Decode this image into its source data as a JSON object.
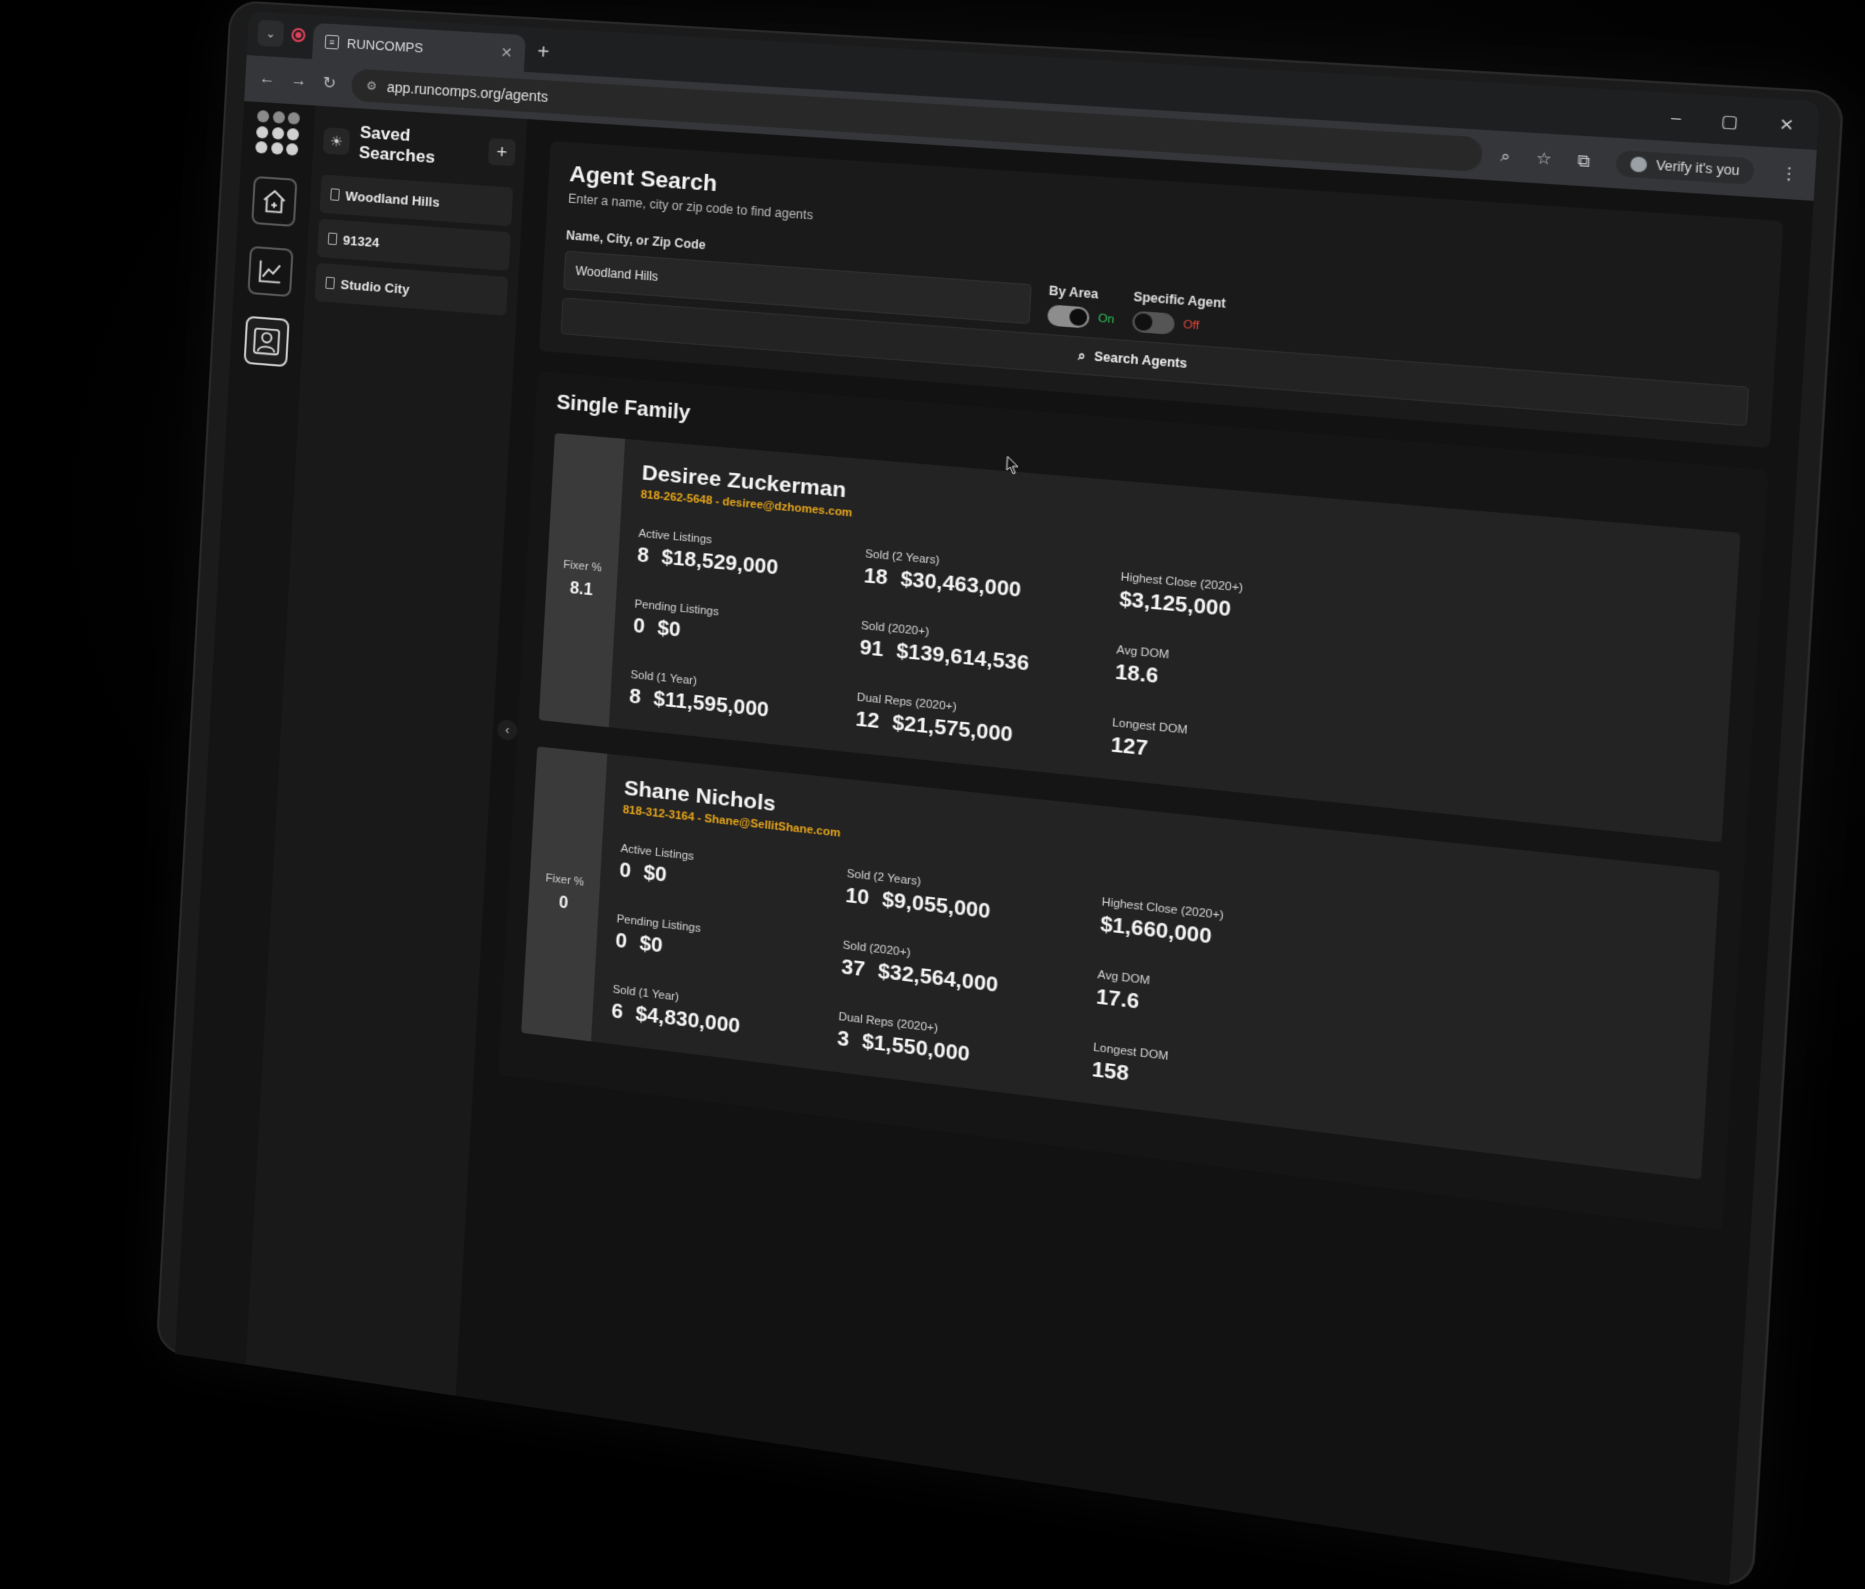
{
  "browser": {
    "tab_title": "RUNCOMPS",
    "url": "app.runcomps.org/agents",
    "verify_label": "Verify it's you"
  },
  "saved_searches": {
    "title": "Saved Searches",
    "items": [
      {
        "label": "Woodland Hills"
      },
      {
        "label": "91324"
      },
      {
        "label": "Studio City"
      }
    ]
  },
  "agent_search": {
    "title": "Agent Search",
    "subtitle": "Enter a name, city or zip code to find agents",
    "field_label": "Name, City, or Zip Code",
    "field_value": "Woodland Hills",
    "by_area": {
      "label": "By Area",
      "state": "On"
    },
    "specific_agent": {
      "label": "Specific Agent",
      "state": "Off"
    },
    "search_button": "Search Agents"
  },
  "section": {
    "title": "Single Family"
  },
  "labels": {
    "fixer": "Fixer %",
    "active": "Active Listings",
    "sold2": "Sold (2 Years)",
    "highest": "Highest Close (2020+)",
    "pending": "Pending Listings",
    "sold2020": "Sold (2020+)",
    "avgdom": "Avg DOM",
    "sold1": "Sold (1 Year)",
    "dual": "Dual Reps (2020+)",
    "longest": "Longest DOM"
  },
  "agents": [
    {
      "name": "Desiree Zuckerman",
      "contact": "818-262-5648 - desiree@dzhomes.com",
      "fixer": "8.1",
      "active_count": "8",
      "active_value": "$18,529,000",
      "sold2_count": "18",
      "sold2_value": "$30,463,000",
      "highest": "$3,125,000",
      "pending_count": "0",
      "pending_value": "$0",
      "sold2020_count": "91",
      "sold2020_value": "$139,614,536",
      "avgdom": "18.6",
      "sold1_count": "8",
      "sold1_value": "$11,595,000",
      "dual_count": "12",
      "dual_value": "$21,575,000",
      "longest": "127"
    },
    {
      "name": "Shane Nichols",
      "contact": "818-312-3164 - Shane@SellitShane.com",
      "fixer": "0",
      "active_count": "0",
      "active_value": "$0",
      "sold2_count": "10",
      "sold2_value": "$9,055,000",
      "highest": "$1,660,000",
      "pending_count": "0",
      "pending_value": "$0",
      "sold2020_count": "37",
      "sold2020_value": "$32,564,000",
      "avgdom": "17.6",
      "sold1_count": "6",
      "sold1_value": "$4,830,000",
      "dual_count": "3",
      "dual_value": "$1,550,000",
      "longest": "158"
    }
  ]
}
